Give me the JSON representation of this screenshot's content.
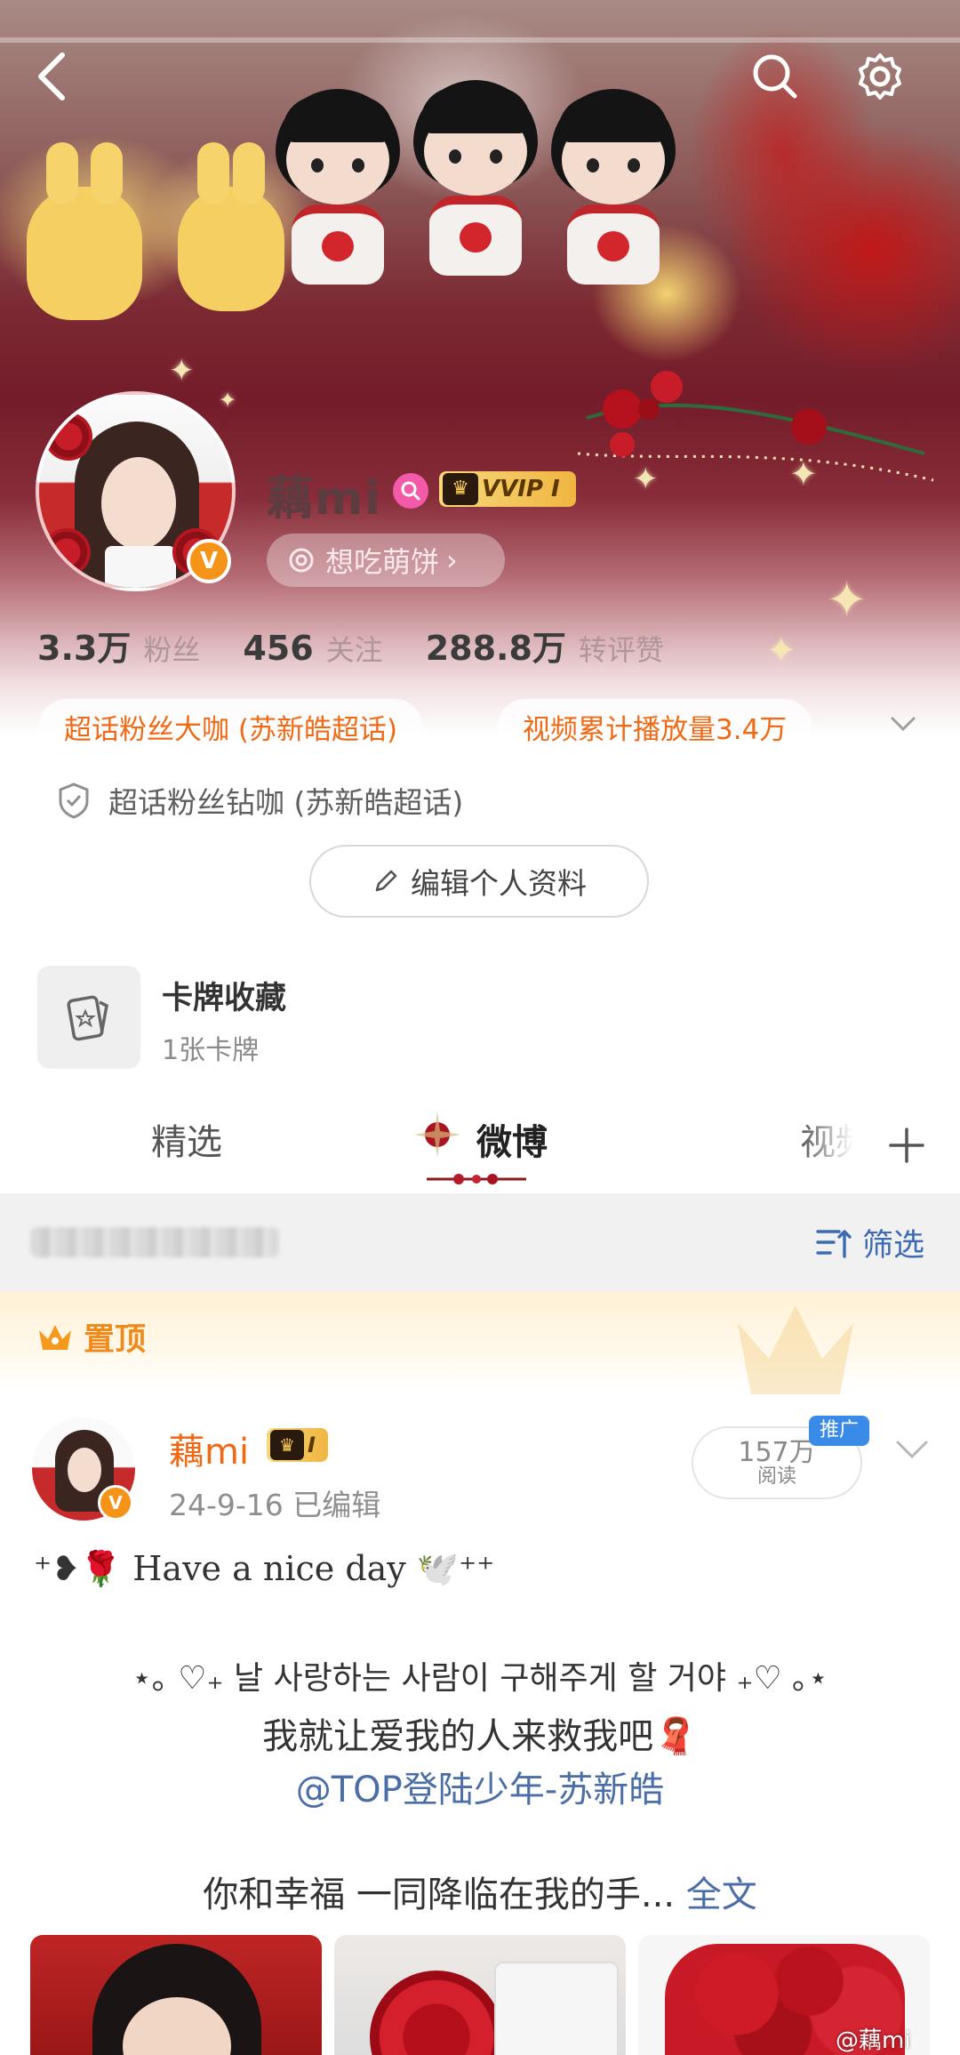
{
  "profile": {
    "name": "藕mi",
    "vip_label": "VVIP I",
    "hobby": "想吃萌饼",
    "hobby_chevron": "›",
    "verified_mark": "V"
  },
  "stats": [
    {
      "value": "3.3万",
      "label": "粉丝"
    },
    {
      "value": "456",
      "label": "关注"
    },
    {
      "value": "288.8万",
      "label": "转评赞"
    }
  ],
  "badges": [
    {
      "label": "超话粉丝大咖 (苏新皓超话)"
    },
    {
      "label": "视频累计播放量3.4万"
    }
  ],
  "diamond_badge": "超话粉丝钻咖 (苏新皓超话)",
  "edit_button": "编辑个人资料",
  "card_collection": {
    "title": "卡牌收藏",
    "subtitle": "1张卡牌"
  },
  "tabs": [
    {
      "label": "精选",
      "active": false
    },
    {
      "label": "微博",
      "active": true
    },
    {
      "label": "视频",
      "active": false
    }
  ],
  "filter_label": "筛选",
  "pinned_label": "置顶",
  "post": {
    "author": "藕mi",
    "vip_level": "I",
    "meta": "24-9-16  已编辑",
    "reads_value": "157万",
    "reads_label": "阅读",
    "promo_tag": "推广",
    "line1": "⁺❥🌹 Have a nice day 🕊️⁺⁺",
    "line2": "⋆｡ ♡₊ 날 사랑하는 사람이 구해주게 할 거야 ₊♡ ｡⋆",
    "line3": "我就让爱我的人来救我吧🧣",
    "mention": "@TOP登陆少年-苏新皓",
    "line5": "你和幸福 一同降临在我的手...",
    "more": "全文"
  },
  "watermark": "@藕mi",
  "colors": {
    "accent_orange": "#f06a16",
    "link_blue": "#4a6ea5",
    "vip_gold": "#f0b540",
    "hero_crimson": "#741c2a"
  },
  "icons": [
    "back-icon",
    "search-icon",
    "gear-icon",
    "magnifier-pink-icon",
    "crown-icon",
    "shield-icon",
    "pencil-icon",
    "card-icon",
    "plus-icon",
    "filter-icon",
    "chevron-down-icon"
  ]
}
